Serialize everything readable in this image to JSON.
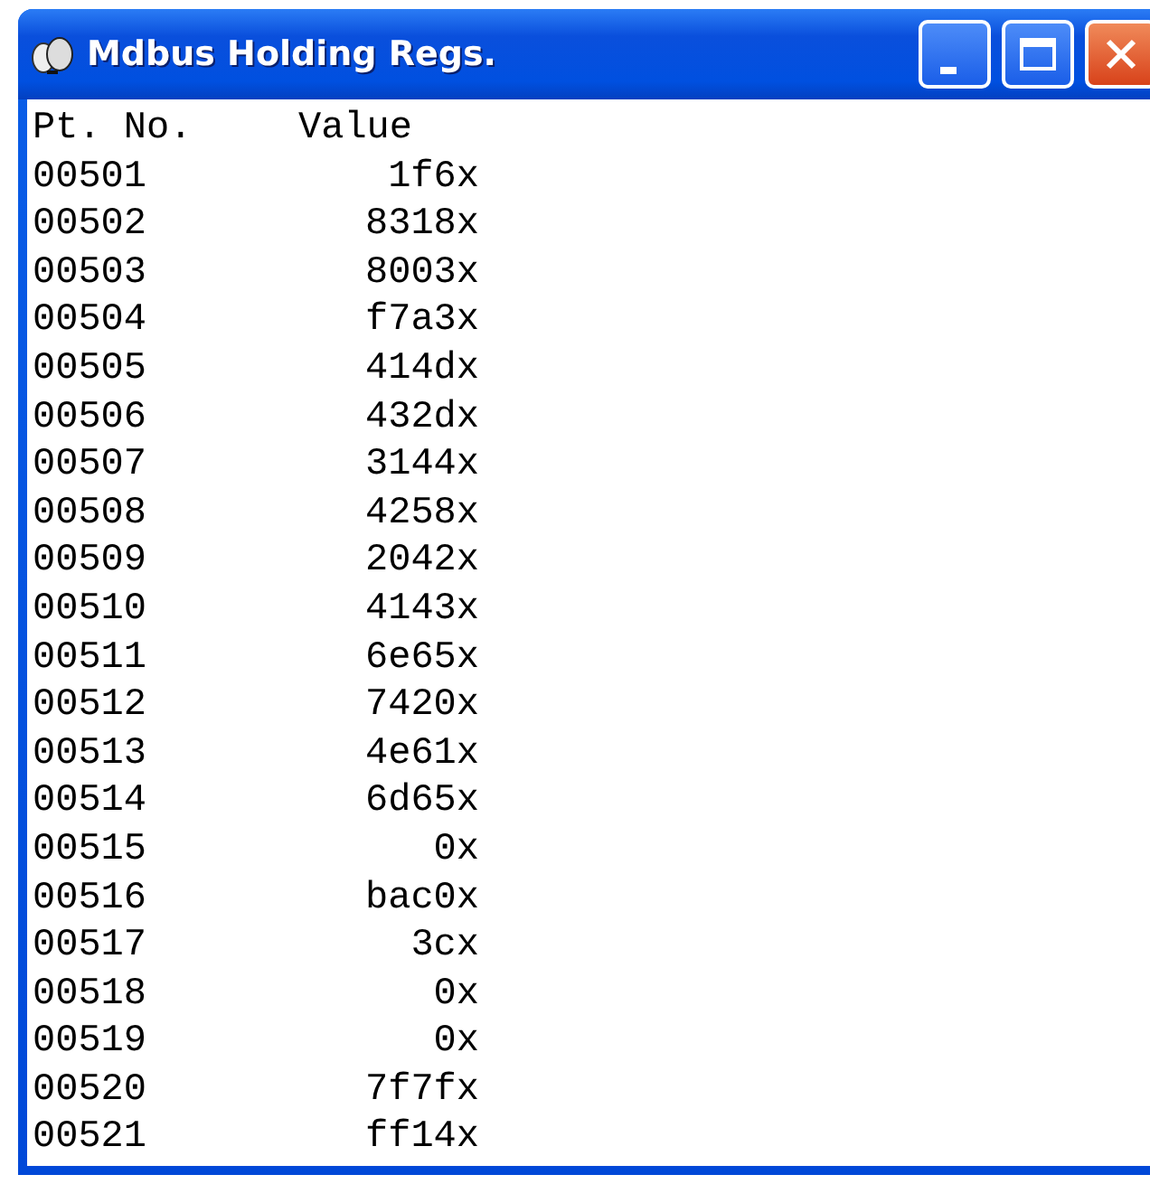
{
  "window": {
    "title": "Mdbus Holding Regs."
  },
  "columns": [
    "Pt. No.",
    "Value"
  ],
  "rows": [
    {
      "point": "00501",
      "value": "1f6x"
    },
    {
      "point": "00502",
      "value": "8318x"
    },
    {
      "point": "00503",
      "value": "8003x"
    },
    {
      "point": "00504",
      "value": "f7a3x"
    },
    {
      "point": "00505",
      "value": "414dx"
    },
    {
      "point": "00506",
      "value": "432dx"
    },
    {
      "point": "00507",
      "value": "3144x"
    },
    {
      "point": "00508",
      "value": "4258x"
    },
    {
      "point": "00509",
      "value": "2042x"
    },
    {
      "point": "00510",
      "value": "4143x"
    },
    {
      "point": "00511",
      "value": "6e65x"
    },
    {
      "point": "00512",
      "value": "7420x"
    },
    {
      "point": "00513",
      "value": "4e61x"
    },
    {
      "point": "00514",
      "value": "6d65x"
    },
    {
      "point": "00515",
      "value": "0x"
    },
    {
      "point": "00516",
      "value": "bac0x"
    },
    {
      "point": "00517",
      "value": "3cx"
    },
    {
      "point": "00518",
      "value": "0x"
    },
    {
      "point": "00519",
      "value": "0x"
    },
    {
      "point": "00520",
      "value": "7f7fx"
    },
    {
      "point": "00521",
      "value": "ff14x"
    }
  ]
}
